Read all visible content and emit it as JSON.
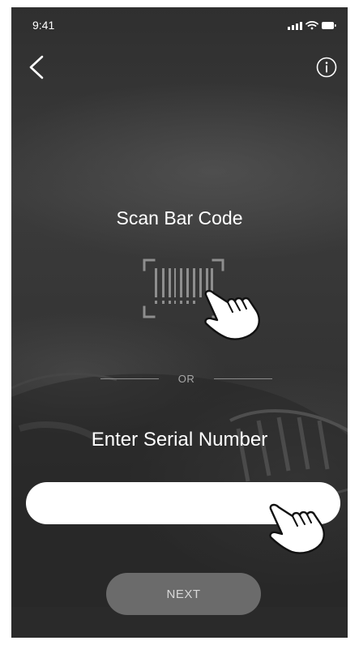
{
  "status_bar": {
    "time": "9:41",
    "icons": [
      "cellular-signal-icon",
      "wifi-icon",
      "battery-icon"
    ]
  },
  "nav": {
    "back_icon": "chevron-left-icon",
    "info_icon": "info-icon"
  },
  "scan": {
    "title": "Scan Bar Code",
    "icon": "barcode-scan-icon",
    "gesture_icon": "tap-hand-icon"
  },
  "divider": {
    "label": "OR"
  },
  "serial": {
    "title": "Enter Serial Number",
    "value": "",
    "placeholder": "",
    "gesture_icon": "tap-hand-icon"
  },
  "actions": {
    "next_label": "NEXT"
  },
  "colors": {
    "background": "#333333",
    "text": "#ffffff",
    "muted": "#a8a8a8",
    "input_bg": "#ffffff",
    "button_bg": "#6b6b6b",
    "button_text": "#d8d8d8"
  }
}
